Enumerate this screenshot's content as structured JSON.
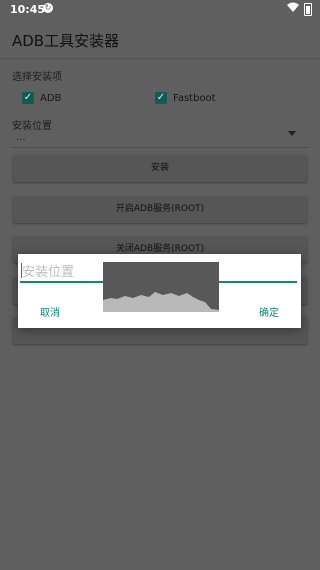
{
  "status_bar": {
    "time": "10:45"
  },
  "app": {
    "title": "ADB工具安装器"
  },
  "options": {
    "label": "选择安装项",
    "items": [
      {
        "label": "ADB",
        "checked": true
      },
      {
        "label": "Fastboot",
        "checked": true
      }
    ]
  },
  "location": {
    "label": "安装位置",
    "value": "..."
  },
  "buttons": {
    "install": "安装",
    "start_adb": "开启ADB服务(ROOT)",
    "stop_adb": "关闭ADB服务(ROOT)"
  },
  "dialog": {
    "input_placeholder": "安装位置",
    "cancel": "取消",
    "confirm": "确定"
  },
  "colors": {
    "accent": "#12867a",
    "checkbox": "#0f5b55",
    "scrim": "#5f5f5f"
  }
}
